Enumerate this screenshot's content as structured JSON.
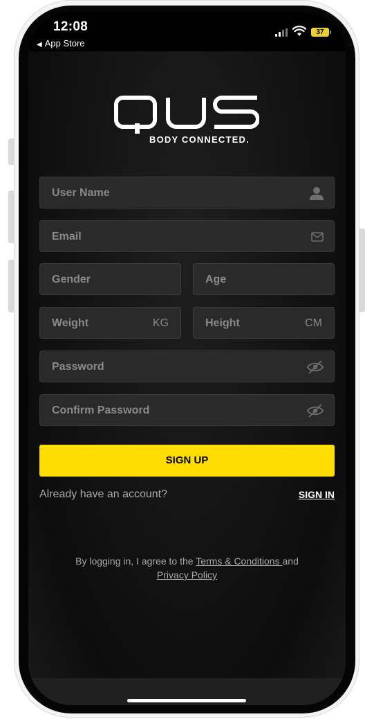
{
  "status": {
    "time": "12:08",
    "back_app": "App Store",
    "battery": "37"
  },
  "brand": {
    "logo_text": "QUS",
    "tagline": "BODY CONNECTED."
  },
  "form": {
    "username_placeholder": "User Name",
    "email_placeholder": "Email",
    "gender_placeholder": "Gender",
    "age_placeholder": "Age",
    "weight_placeholder": "Weight",
    "weight_unit": "KG",
    "height_placeholder": "Height",
    "height_unit": "CM",
    "password_placeholder": "Password",
    "confirm_password_placeholder": "Confirm Password"
  },
  "actions": {
    "signup_label": "SIGN UP",
    "already_text": "Already have an account?",
    "signin_label": "SIGN IN"
  },
  "legal": {
    "prefix": "By logging in, I agree to the ",
    "terms": "Terms & Conditions ",
    "and": "and",
    "privacy": "Privacy Policy"
  },
  "colors": {
    "accent": "#ffdd00",
    "field_bg": "#2a2a2a",
    "placeholder": "#8a8a8a"
  }
}
